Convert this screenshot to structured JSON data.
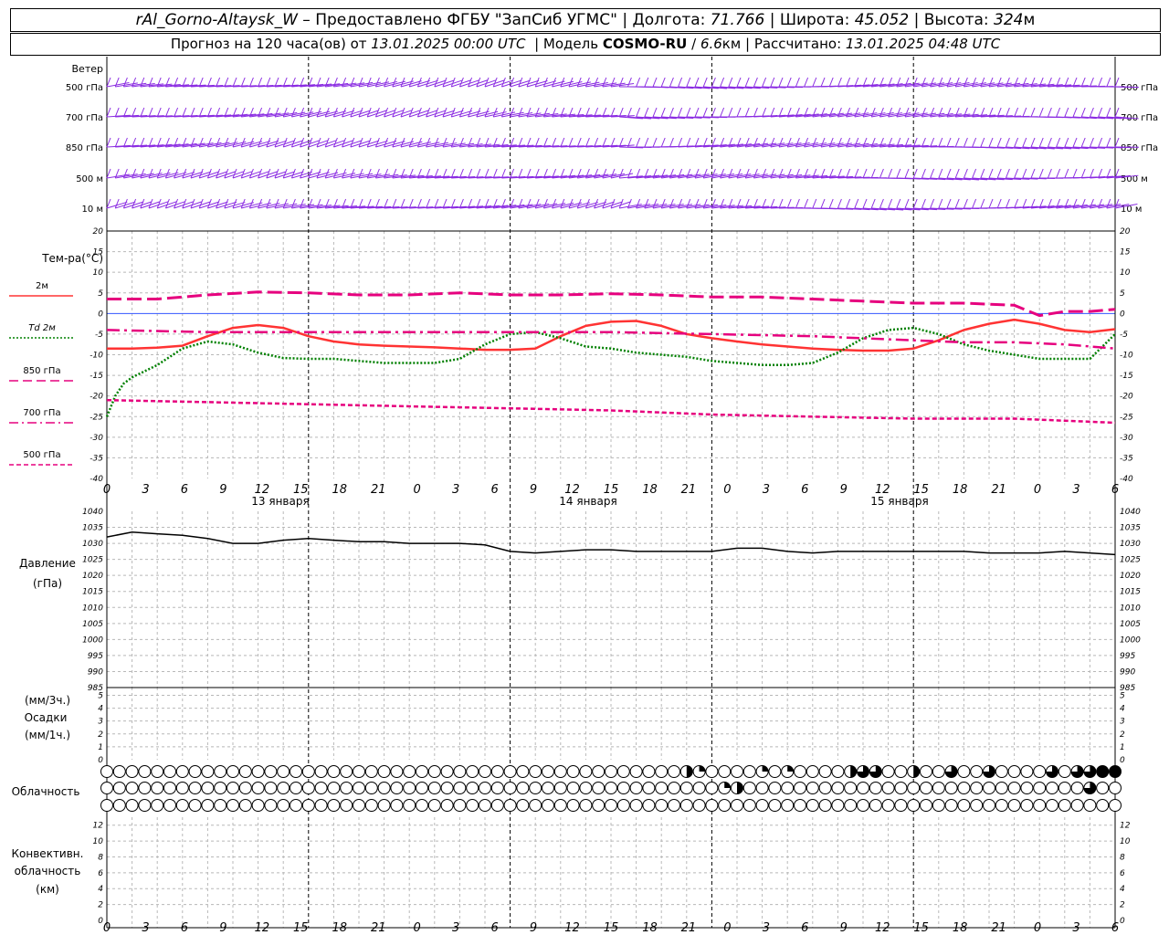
{
  "header": {
    "station": "rAl_Gorno-Altaysk_W",
    "dash": " – ",
    "provided": "Предоставлено ФГБУ \"ЗапСиб УГМС\"",
    "lon_label": "Долгота:",
    "lon_value": "71.766",
    "lat_label": "Широта:",
    "lat_value": "45.052",
    "alt_label": "Высота:",
    "alt_value": "324",
    "alt_unit": "м",
    "forecast_prefix": "Прогноз на 120 часа(ов)  от",
    "forecast_time": "13.01.2025 00:00 UTC",
    "model_label": "Модель",
    "model_name": "COSMO-RU",
    "model_res": "6.6",
    "model_unit": "км",
    "calc_label": "Рассчитано:",
    "calc_time": "13.01.2025 04:48 UTC",
    "sep": "|"
  },
  "wind": {
    "title": "Ветер",
    "levels": [
      "500 гПа",
      "700 гПа",
      "850 гПа",
      "500 м",
      "10  м"
    ],
    "color": "#8a2be2"
  },
  "time_axis": {
    "hour_labels": [
      "0",
      "3",
      "6",
      "9",
      "12",
      "15",
      "18",
      "21",
      "0",
      "3",
      "6",
      "9",
      "12",
      "15",
      "18",
      "21",
      "0",
      "3",
      "6",
      "9",
      "12",
      "15",
      "18",
      "21",
      "0",
      "3",
      "6"
    ],
    "dates": [
      "13 января",
      "14 января",
      "15 января"
    ]
  },
  "temperature": {
    "title": "Тем-ра(°С)",
    "legend": [
      {
        "label": "2м",
        "color": "#ff3333",
        "style": "solid"
      },
      {
        "label": "Td  2м",
        "color": "#008000",
        "style": "dotted"
      },
      {
        "label": "850 гПа",
        "color": "#e6007e",
        "style": "dash"
      },
      {
        "label": "700 гПа",
        "color": "#e6007e",
        "style": "dashdot"
      },
      {
        "label": "500 гПа",
        "color": "#e6007e",
        "style": "shortdash"
      }
    ],
    "ticks": [
      "20",
      "15",
      "10",
      "5",
      "0",
      "-5",
      "-10",
      "-15",
      "-20",
      "-25",
      "-30",
      "-35",
      "-40"
    ]
  },
  "pressure": {
    "title": "Давление",
    "unit": "(гПа)",
    "ticks": [
      "1040",
      "1035",
      "1030",
      "1025",
      "1020",
      "1015",
      "1010",
      "1005",
      "1000",
      "995",
      "990",
      "985"
    ]
  },
  "precip": {
    "unit3": "(мм/3ч.)",
    "title": "Осадки",
    "unit1": "(мм/1ч.)",
    "ticks": [
      "5",
      "4",
      "3",
      "2",
      "1",
      "0"
    ]
  },
  "clouds": {
    "title": "Облачность"
  },
  "convective": {
    "title1": "Конвективн.",
    "title2": "облачность",
    "unit": "(км)",
    "ticks": [
      "12",
      "10",
      "8",
      "6",
      "4",
      "2",
      "0"
    ]
  },
  "chart_data": [
    {
      "type": "line",
      "title": "Тем-ра(°С)",
      "x_unit": "hours from 13.01.2025 00:00 UTC",
      "ylim": [
        -40,
        20
      ],
      "series": [
        {
          "name": "2м",
          "x": [
            0,
            3,
            6,
            9,
            12,
            15,
            18,
            21,
            24,
            27,
            30,
            33,
            36,
            39,
            42,
            45,
            48,
            51,
            54,
            57,
            60,
            63,
            66,
            69,
            72,
            75,
            78,
            81,
            84,
            87,
            90,
            93,
            96,
            99,
            102,
            105,
            108,
            111,
            114,
            117,
            120
          ],
          "values": [
            -8.5,
            -8.5,
            -8.3,
            -7.8,
            -5.5,
            -3.5,
            -2.8,
            -3.5,
            -5.5,
            -6.8,
            -7.5,
            -7.8,
            -8,
            -8.2,
            -8.5,
            -8.8,
            -8.8,
            -8.5,
            -5.5,
            -3,
            -2,
            -1.8,
            -3,
            -5,
            -6,
            -6.8,
            -7.5,
            -8,
            -8.5,
            -8.8,
            -9,
            -9,
            -8.5,
            -6.5,
            -4,
            -2.5,
            -1.5,
            -2.5,
            -4,
            -4.5,
            -3.8
          ]
        },
        {
          "name": "Td  2м",
          "x": [
            0,
            1,
            2,
            3,
            6,
            9,
            12,
            15,
            18,
            21,
            24,
            27,
            30,
            33,
            36,
            39,
            42,
            45,
            48,
            51,
            54,
            57,
            60,
            63,
            66,
            69,
            72,
            75,
            78,
            81,
            84,
            87,
            90,
            93,
            96,
            99,
            102,
            105,
            108,
            111,
            114,
            117,
            120
          ],
          "values": [
            -25,
            -20,
            -17,
            -15.5,
            -12.5,
            -8.5,
            -6.8,
            -7.5,
            -9.5,
            -10.8,
            -11,
            -11,
            -11.5,
            -12,
            -12,
            -12,
            -11,
            -7.5,
            -5,
            -4.5,
            -6,
            -8,
            -8.5,
            -9.5,
            -10,
            -10.5,
            -11.5,
            -12,
            -12.5,
            -12.5,
            -12,
            -9.5,
            -6,
            -4,
            -3.5,
            -5,
            -7.5,
            -9,
            -10,
            -11,
            -11,
            -11,
            -5
          ]
        },
        {
          "name": "850 гПа",
          "x": [
            0,
            6,
            12,
            18,
            24,
            30,
            36,
            42,
            48,
            54,
            60,
            66,
            72,
            78,
            84,
            90,
            96,
            102,
            108,
            111,
            114,
            117,
            120
          ],
          "values": [
            3.5,
            3.5,
            4.5,
            5.2,
            5,
            4.5,
            4.5,
            5,
            4.5,
            4.5,
            4.8,
            4.5,
            4,
            4,
            3.5,
            3,
            2.5,
            2.5,
            2,
            -0.5,
            0.5,
            0.5,
            1
          ]
        },
        {
          "name": "700 гПа",
          "x": [
            0,
            12,
            24,
            36,
            48,
            60,
            72,
            84,
            96,
            102,
            108,
            114,
            120
          ],
          "values": [
            -4,
            -4.5,
            -4.5,
            -4.5,
            -4.5,
            -4.5,
            -5,
            -5.5,
            -6.5,
            -7,
            -7,
            -7.5,
            -8.5
          ]
        },
        {
          "name": "500 гПа",
          "x": [
            0,
            12,
            24,
            36,
            48,
            60,
            72,
            84,
            96,
            108,
            120
          ],
          "values": [
            -21,
            -21.5,
            -22,
            -22.5,
            -23,
            -23.5,
            -24.5,
            -25,
            -25.5,
            -25.5,
            -26.5
          ]
        }
      ]
    },
    {
      "type": "line",
      "title": "Давление",
      "x_unit": "hours from 13.01.2025 00:00 UTC",
      "ylim": [
        985,
        1040
      ],
      "series": [
        {
          "name": "",
          "x": [
            0,
            3,
            6,
            9,
            12,
            15,
            18,
            21,
            24,
            27,
            30,
            33,
            36,
            39,
            42,
            45,
            48,
            51,
            54,
            57,
            60,
            63,
            66,
            69,
            72,
            75,
            78,
            81,
            84,
            87,
            90,
            93,
            96,
            99,
            102,
            105,
            108,
            111,
            114,
            117,
            120
          ],
          "values": [
            1032,
            1033.5,
            1033,
            1032.5,
            1031.5,
            1030,
            1030,
            1031,
            1031.5,
            1031,
            1030.5,
            1030.5,
            1030,
            1030,
            1030,
            1029.5,
            1027.5,
            1027,
            1027.5,
            1028,
            1028,
            1027.5,
            1027.5,
            1027.5,
            1027.5,
            1028.5,
            1028.5,
            1027.5,
            1027,
            1027.5,
            1027.5,
            1027.5,
            1027.5,
            1027.5,
            1027.5,
            1027,
            1027,
            1027,
            1027.5,
            1027,
            1026.5
          ]
        }
      ]
    },
    {
      "type": "bar",
      "title": "Осадки",
      "ylim": [
        0,
        5
      ],
      "categories": [],
      "values": []
    },
    {
      "type": "bar",
      "title": "Конвективн. облачность",
      "ylim": [
        0,
        13
      ],
      "categories": [],
      "values": []
    }
  ]
}
